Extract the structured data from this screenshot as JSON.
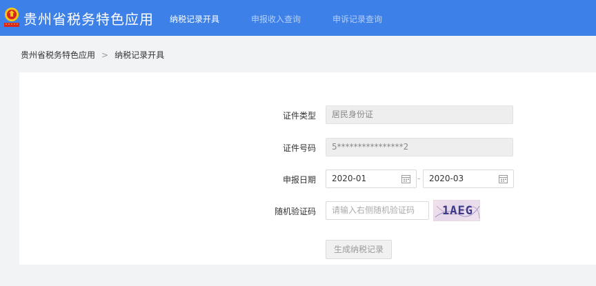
{
  "header": {
    "app_title": "贵州省税务特色应用",
    "nav": [
      {
        "label": "纳税记录开具",
        "active": true
      },
      {
        "label": "申报收入查询",
        "active": false
      },
      {
        "label": "申诉记录查询",
        "active": false
      }
    ],
    "bg_color": "#3d80e8"
  },
  "breadcrumb": {
    "items": [
      "贵州省税务特色应用",
      "纳税记录开具"
    ],
    "separator": ">"
  },
  "form": {
    "id_type": {
      "label": "证件类型",
      "value": "居民身份证"
    },
    "id_number": {
      "label": "证件号码",
      "value": "5****************2"
    },
    "report_date": {
      "label": "申报日期",
      "start": "2020-01",
      "end": "2020-03",
      "separator": "-"
    },
    "captcha": {
      "label": "随机验证码",
      "placeholder": "请输入右侧随机验证码",
      "image_text": "1AEG"
    },
    "submit_label": "生成纳税记录"
  }
}
